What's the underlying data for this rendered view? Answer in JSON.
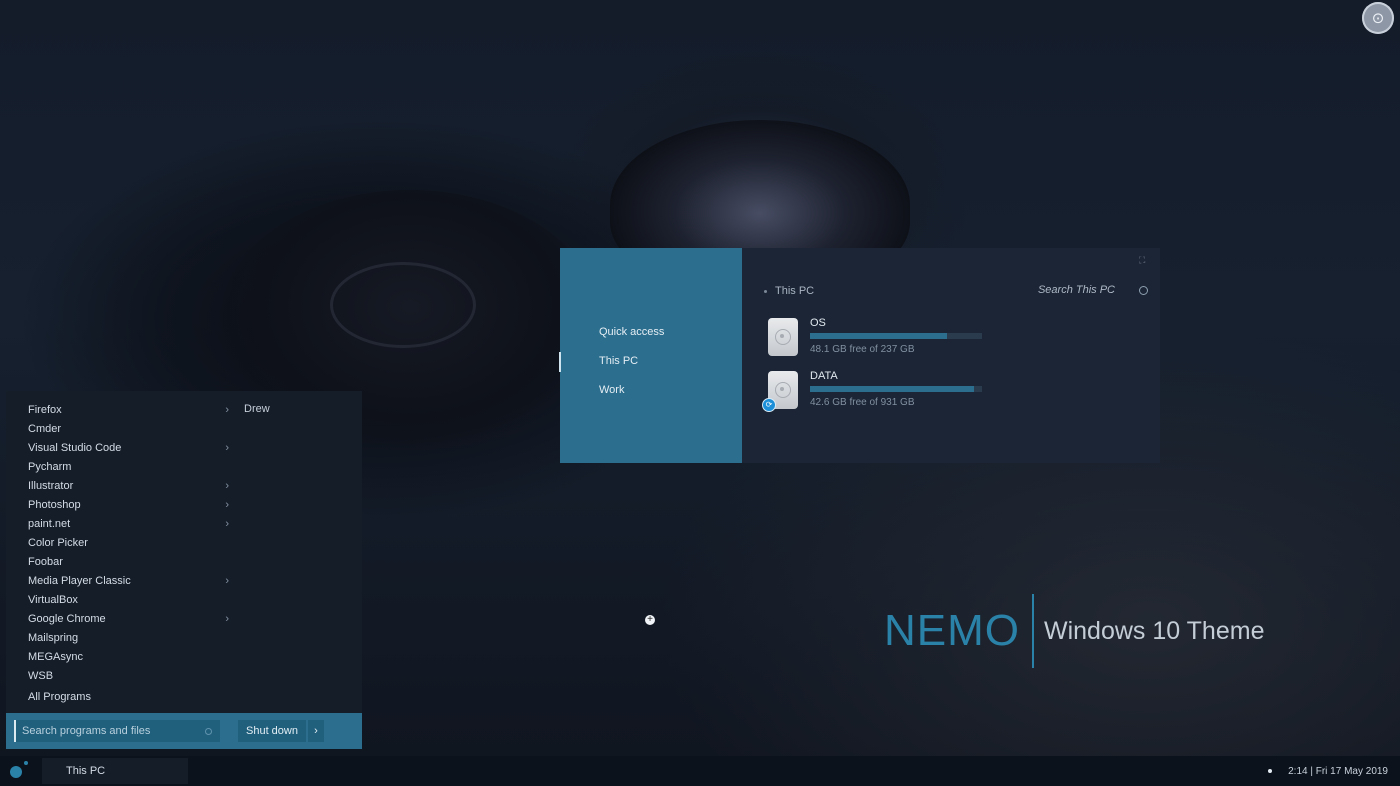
{
  "explorer": {
    "nav_items": [
      {
        "label": "Quick access"
      },
      {
        "label": "This PC"
      },
      {
        "label": "Work"
      }
    ],
    "active_nav": "This PC",
    "breadcrumb": "This PC",
    "search_placeholder": "Search This PC",
    "drives": [
      {
        "name": "OS",
        "free_text": "48.1 GB free of 237 GB",
        "used_fraction": 0.797
      },
      {
        "name": "DATA",
        "free_text": "42.6 GB free of 931 GB",
        "used_fraction": 0.954
      }
    ]
  },
  "start_menu": {
    "programs": [
      {
        "label": "Firefox",
        "has_submenu": true
      },
      {
        "label": "Cmder",
        "has_submenu": false
      },
      {
        "label": "Visual Studio Code",
        "has_submenu": true
      },
      {
        "label": "Pycharm",
        "has_submenu": false
      },
      {
        "label": "Illustrator",
        "has_submenu": true
      },
      {
        "label": "Photoshop",
        "has_submenu": true
      },
      {
        "label": "paint.net",
        "has_submenu": true
      },
      {
        "label": "Color Picker",
        "has_submenu": false
      },
      {
        "label": "Foobar",
        "has_submenu": false
      },
      {
        "label": "Media Player Classic",
        "has_submenu": true
      },
      {
        "label": "VirtualBox",
        "has_submenu": false
      },
      {
        "label": "Google Chrome",
        "has_submenu": true
      },
      {
        "label": "Mailspring",
        "has_submenu": false
      },
      {
        "label": "MEGAsync",
        "has_submenu": false
      },
      {
        "label": "WSB",
        "has_submenu": false
      }
    ],
    "all_programs_label": "All Programs",
    "user_name": "Drew",
    "search_placeholder": "Search programs and files",
    "shutdown_label": "Shut down"
  },
  "brand": {
    "name": "NEMO",
    "subtitle": "Windows 10 Theme"
  },
  "taskbar": {
    "app_label": "This PC",
    "clock": "2:14 | Fri 17 May 2019"
  },
  "colors": {
    "accent": "#2b6e8e",
    "brand": "#2b82a9",
    "panel": "#151d29"
  },
  "icons": {
    "corner": "screen-capture-icon",
    "drive": "hard-drive-icon",
    "submenu": "chevron-right-icon"
  }
}
